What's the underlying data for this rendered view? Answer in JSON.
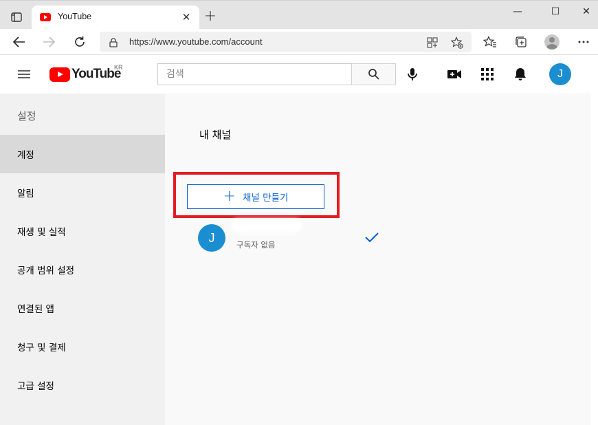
{
  "browser": {
    "tab_title": "YouTube",
    "tab_close": "✕",
    "new_tab": "+",
    "url": "https://www.youtube.com/account",
    "win_minimize": "—",
    "win_maximize": "☐",
    "win_close": "✕"
  },
  "masthead": {
    "logo_text": "YouTube",
    "country": "KR",
    "search_placeholder": "검색",
    "avatar_letter": "J",
    "brand_color": "#ff0000"
  },
  "sidebar": {
    "heading": "설정",
    "items": [
      {
        "label": "계정",
        "active": true
      },
      {
        "label": "알림"
      },
      {
        "label": "재생 및 실적"
      },
      {
        "label": "공개 범위 설정"
      },
      {
        "label": "연결된 앱"
      },
      {
        "label": "청구 및 결제"
      },
      {
        "label": "고급 설정"
      }
    ]
  },
  "main": {
    "section_title": "내 채널",
    "create_channel_label": "채널 만들기",
    "create_channel_plus": "+",
    "channel": {
      "avatar_letter": "J",
      "subscribers": "구독자 없음"
    },
    "accent_color": "#065fd4",
    "highlight_color": "#e31b23"
  }
}
